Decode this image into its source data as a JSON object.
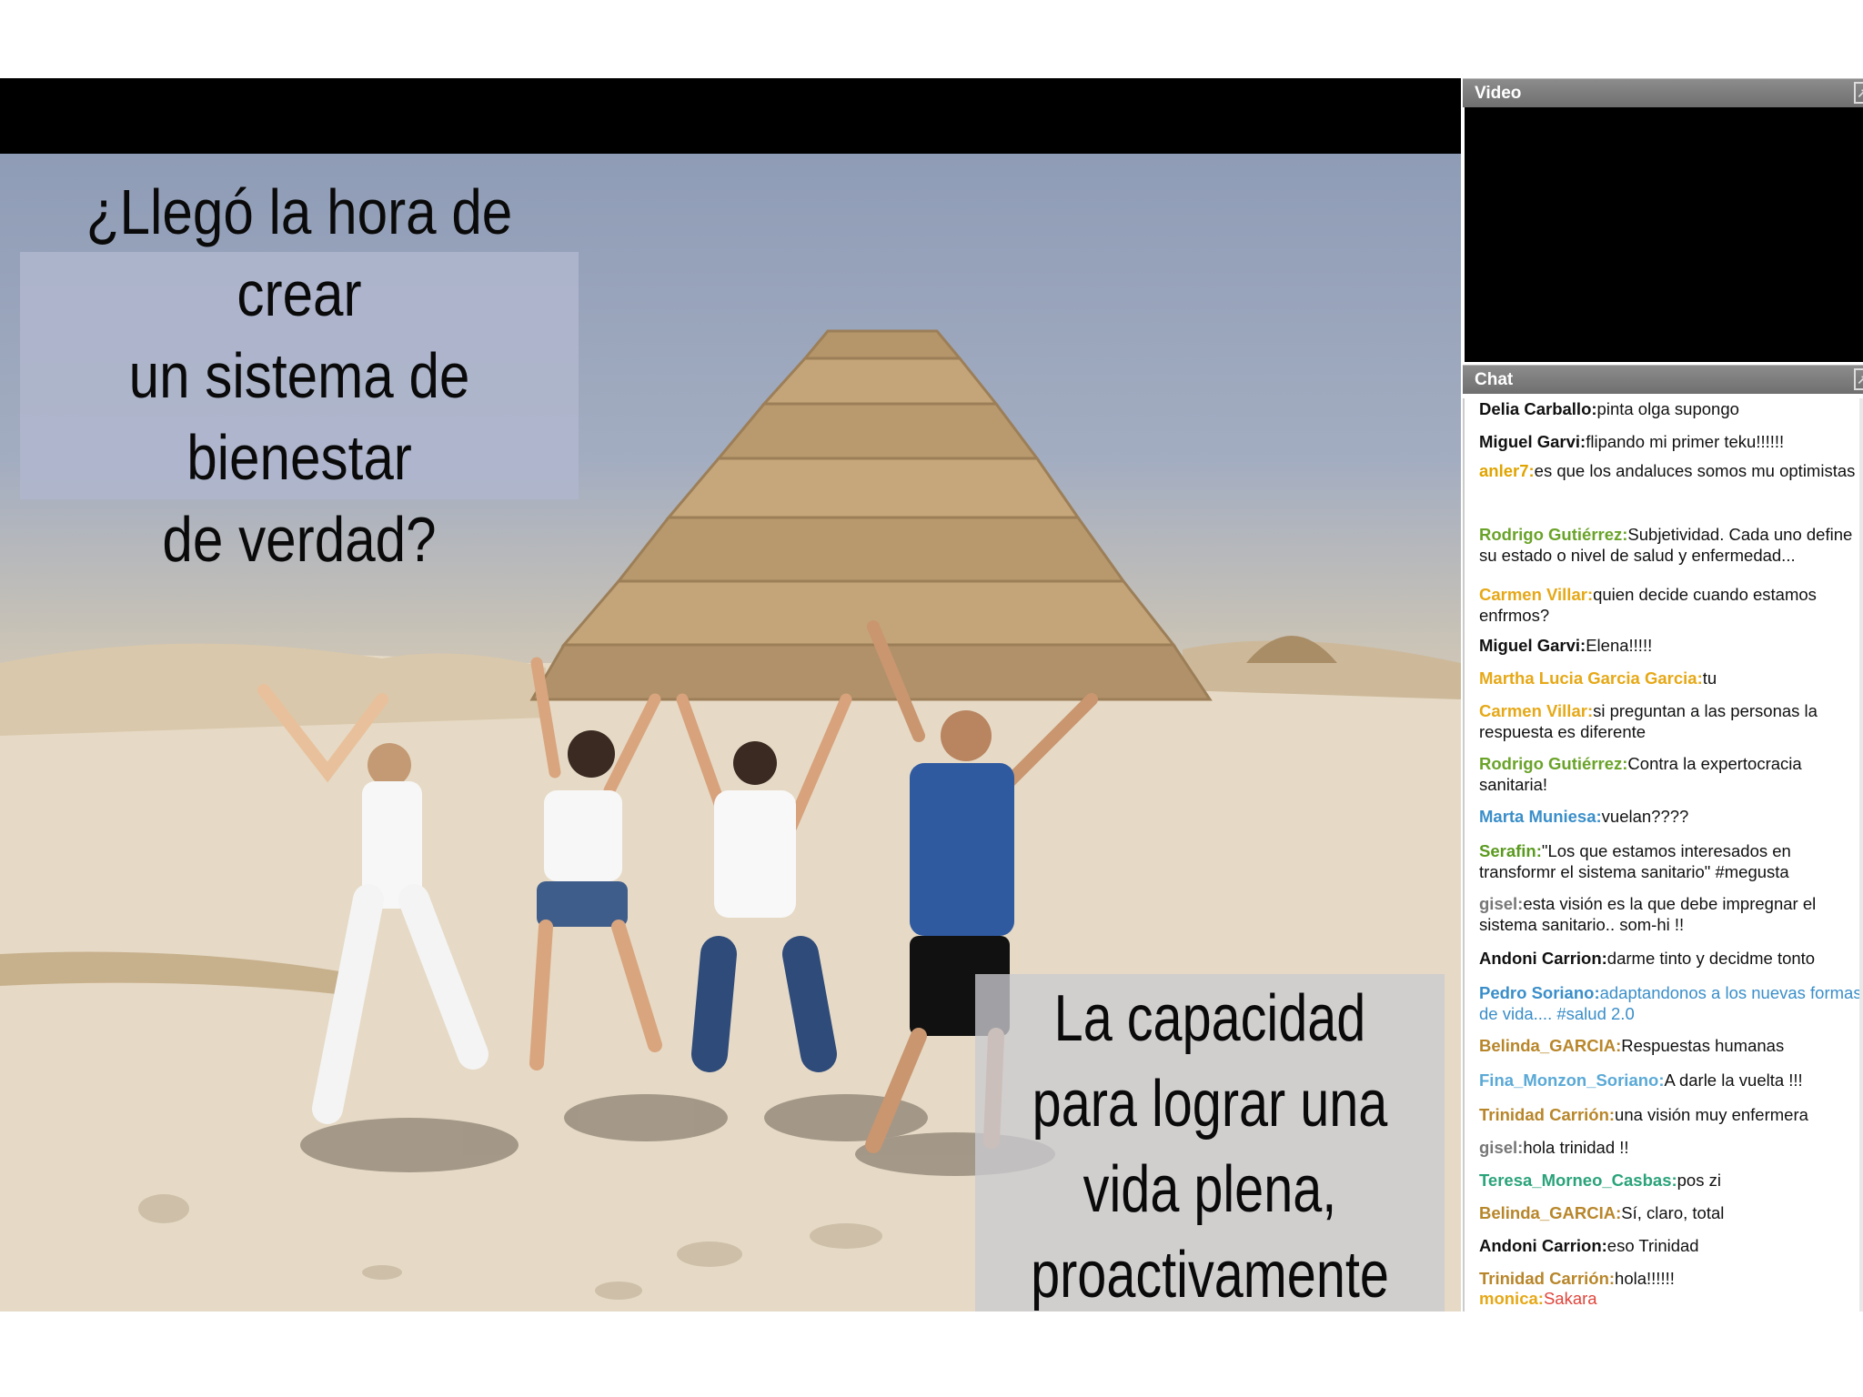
{
  "slide": {
    "top_text": "¿Llegó la hora de crear\nun sistema de bienestar\nde verdad?",
    "bottom_text": "La capacidad\npara lograr una\nvida plena,\nproactivamente"
  },
  "video_panel": {
    "title": "Video"
  },
  "chat_panel": {
    "title": "Chat",
    "messages": [
      {
        "nick": "Delia Carballo:",
        "text": "pinta olga supongo",
        "color": "#111111"
      },
      {
        "nick": "Miguel Garvi:",
        "text": "flipando mi primer teku!!!!!!",
        "color": "#111111"
      },
      {
        "nick": "anler7:",
        "text": "es que los andaluces somos mu optimistas",
        "color": "#e0a400"
      },
      {
        "nick": "Rodrigo Gutiérrez:",
        "text": "Subjetividad. Cada uno define su estado o nivel de salud y enfermedad...",
        "color": "#6aa329"
      },
      {
        "nick": "Carmen Villar:",
        "text": "quien decide cuando estamos enfrmos?",
        "color": "#e6a817"
      },
      {
        "nick": "Miguel Garvi:",
        "text": "Elena!!!!!",
        "color": "#111111"
      },
      {
        "nick": "Martha Lucia Garcia Garcia:",
        "text": "tu",
        "color": "#e6a817"
      },
      {
        "nick": "Carmen Villar:",
        "text": "si preguntan a las personas la respuesta es diferente",
        "color": "#e6a817"
      },
      {
        "nick": "Rodrigo Gutiérrez:",
        "text": "Contra la expertocracia sanitaria!",
        "color": "#6aa329"
      },
      {
        "nick": "Marta Muniesa:",
        "text": "vuelan????",
        "color": "#3a8ec9"
      },
      {
        "nick": "Serafin:",
        "text": "\"Los que estamos interesados en transformr el sistema sanitario\" #megusta",
        "color": "#5a9a1f"
      },
      {
        "nick": "gisel:",
        "text": "esta visión es la que debe impregnar el sistema sanitario.. som-hi !!",
        "color": "#777777"
      },
      {
        "nick": "Andoni Carrion:",
        "text": "darme tinto y decidme tonto",
        "color": "#111111"
      },
      {
        "nick": "Pedro Soriano:",
        "text": "adaptandonos a los nuevas formas de vida.... #salud 2.0",
        "color": "#3a8ec9",
        "text_color": "#3a8ec9"
      },
      {
        "nick": "Belinda_GARCIA:",
        "text": "Respuestas humanas",
        "color": "#b8862a"
      },
      {
        "nick": "Fina_Monzon_Soriano:",
        "text": "A darle la vuelta !!!",
        "color": "#5aa9d6"
      },
      {
        "nick": "Trinidad Carrión:",
        "text": "una visión muy enfermera",
        "color": "#b8862a"
      },
      {
        "nick": "gisel:",
        "text": "hola trinidad !!",
        "color": "#777777"
      },
      {
        "nick": "Teresa_Morneo_Casbas:",
        "text": "pos zi",
        "color": "#2aa37a"
      },
      {
        "nick": "Belinda_GARCIA:",
        "text": "Sí, claro, total",
        "color": "#b8862a"
      },
      {
        "nick": "Andoni Carrion:",
        "text": "eso Trinidad",
        "color": "#111111"
      },
      {
        "nick": "Trinidad Carrión:",
        "text": "hola!!!!!!",
        "color": "#b8862a"
      },
      {
        "nick": "monica:",
        "text": "Sakara",
        "color": "#e6a817",
        "text_color": "#e0443a"
      }
    ]
  }
}
